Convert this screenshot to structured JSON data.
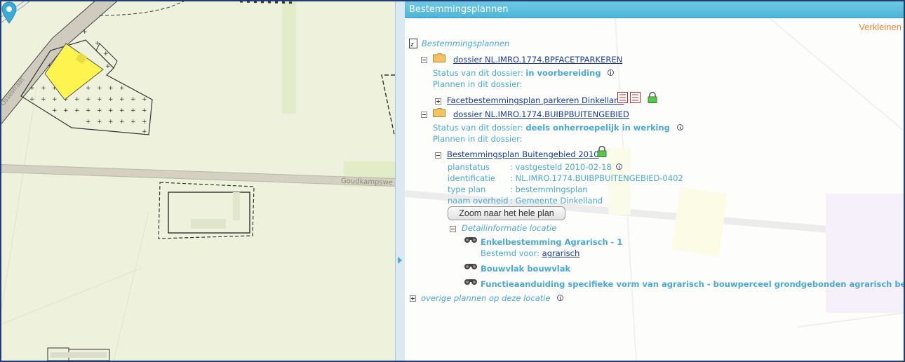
{
  "map": {
    "road_label_top": "Goudkampsweg",
    "road_label_left": "Ossestraat",
    "road_label_main": "Goudkampswe"
  },
  "panel": {
    "title": "Bestemmingsplannen",
    "collapse_label": "Verkleinen",
    "root_label": "Bestemmingsplannen",
    "dossier1": {
      "link": "dossier NL.IMRO.1774.BPFACETPARKEREN",
      "status_label": "Status van dit dossier:",
      "status_value": "in voorbereiding",
      "plans_label": "Plannen in dit dossier:",
      "plan_link": "Facetbestemmingsplan parkeren Dinkelland"
    },
    "dossier2": {
      "link": "dossier NL.IMRO.1774.BUIBPBUITENGEBIED",
      "status_label": "Status van dit dossier:",
      "status_value": "deels onherroepelijk in werking",
      "plans_label": "Plannen in dit dossier:",
      "plan_link": "Bestemmingsplan Buitengebied 2010",
      "props": [
        {
          "key": "planstatus",
          "value": ": vastgesteld 2010-02-18"
        },
        {
          "key": "identificatie",
          "value": ": NL.IMRO.1774.BUIBPBUITENGEBIED-0402"
        },
        {
          "key": "type plan",
          "value": ": bestemmingsplan"
        },
        {
          "key": "naam overheid",
          "value": ": Gemeente Dinkelland"
        }
      ],
      "zoom_button": "Zoom naar het hele plan",
      "detail_label": "Detailinformatie locatie",
      "details": {
        "item1_title": "Enkelbestemming Agrarisch - 1",
        "item1_sub_label": "Bestemd voor:",
        "item1_sub_link": "agrarisch",
        "item2_title": "Bouwvlak bouwvlak",
        "item3_title": "Functieaanduiding specifieke vorm van agrarisch - bouwperceel grondgebonden agrarisch bedrijf"
      }
    },
    "other_plans": "overige plannen op deze locatie"
  },
  "colors": {
    "header": "#4fb6d8",
    "accent_link": "#1a3a9e",
    "text_blue": "#4aa9d6",
    "collapse": "#e8843a",
    "highlight_parcel": "#fff44f"
  }
}
